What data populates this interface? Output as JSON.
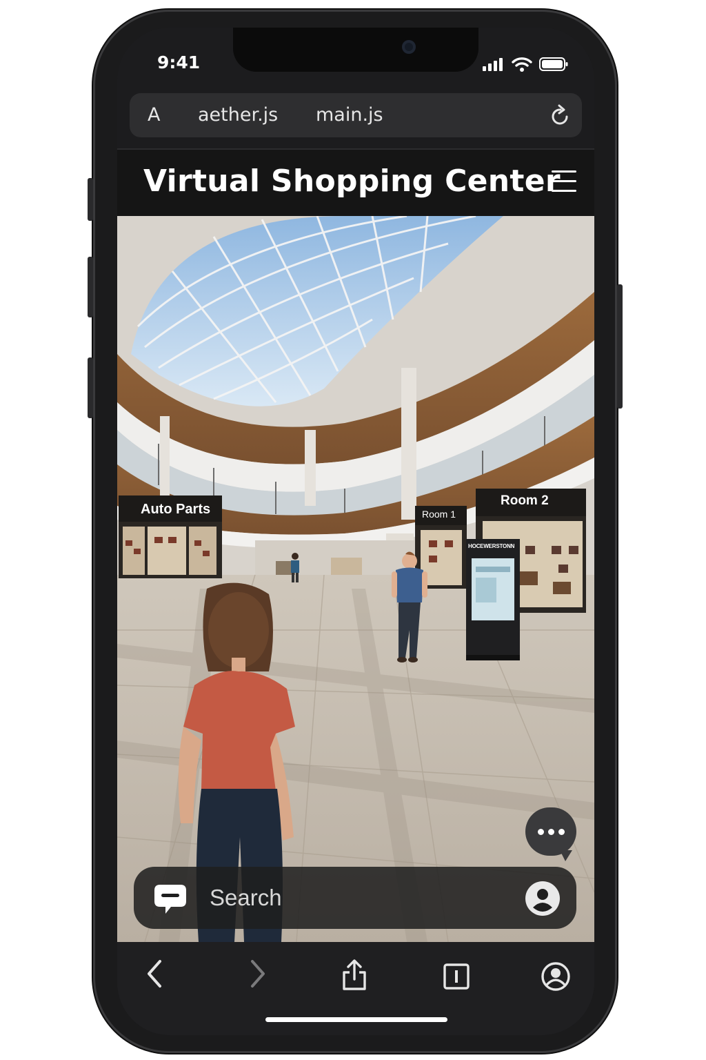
{
  "status_bar": {
    "time": "9:41",
    "icons": [
      "signal-icon",
      "wifi-icon",
      "battery-icon"
    ]
  },
  "url_bar": {
    "reader_label": "A",
    "tabs": [
      "aether.js",
      "main.js"
    ],
    "reload_icon": "reload-icon"
  },
  "app_header": {
    "title": "Virtual Shopping Center",
    "menu_icon": "hamburger-menu-icon"
  },
  "scene": {
    "store_signs": [
      "Auto Parts",
      "Room 1",
      "Room 2"
    ],
    "kiosk_sign": "HOCEWERSTONN"
  },
  "chat": {
    "fab_icon": "more-chat-icon"
  },
  "search": {
    "placeholder": "Search",
    "left_icon": "chat-bubble-icon",
    "right_icon": "profile-icon"
  },
  "toolbar": {
    "items": [
      "back-icon",
      "forward-icon",
      "share-icon",
      "tabs-icon",
      "account-icon"
    ]
  },
  "colors": {
    "screen_bg": "#1c1c1e",
    "header_bg": "#151515",
    "accent_white": "#ffffff"
  }
}
